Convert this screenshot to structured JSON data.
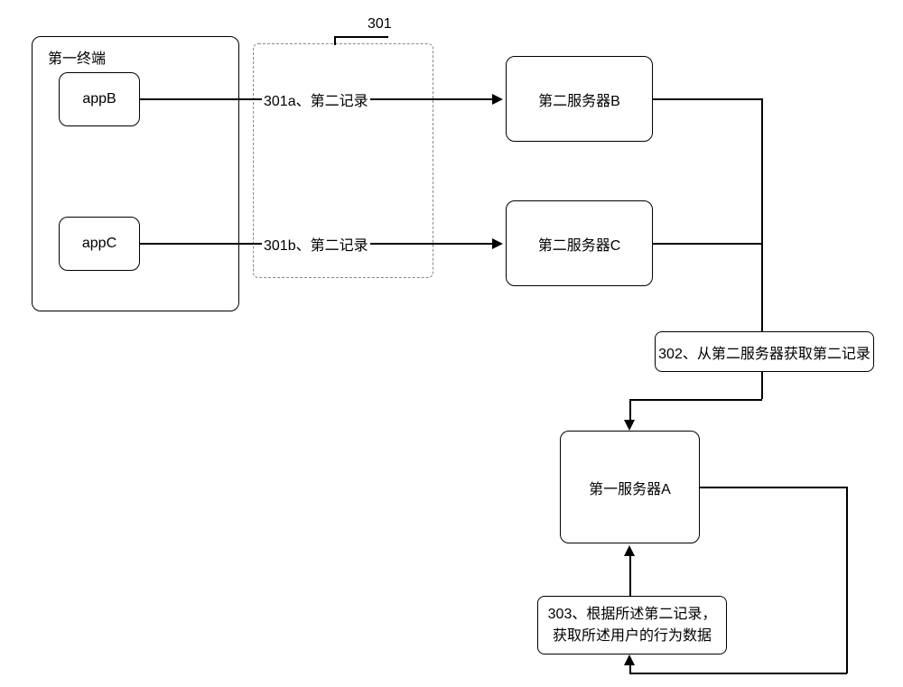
{
  "terminal": {
    "title": "第一终端",
    "appB": "appB",
    "appC": "appC"
  },
  "step301": {
    "number": "301",
    "label_a": "301a、第二记录",
    "label_b": "301b、第二记录"
  },
  "serverB": "第二服务器B",
  "serverC": "第二服务器C",
  "step302": "302、从第二服务器获取第二记录",
  "serverA": "第一服务器A",
  "step303": "303、根据所述第二记录，获取所述用户的行为数据"
}
